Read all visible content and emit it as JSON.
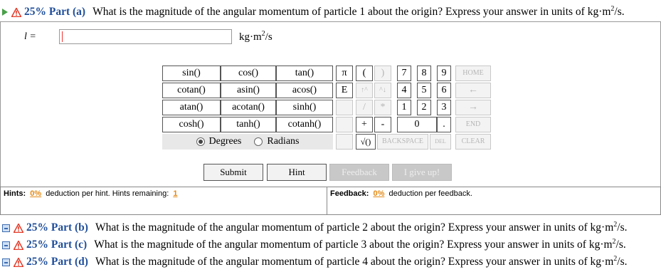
{
  "parts": {
    "a": {
      "percent": "25% Part (a)",
      "question": "What is the magnitude of the angular momentum of particle 1 about the origin? Express your answer in units of kg·m",
      "unit_sup": "2",
      "unit_end": "/s."
    },
    "b": {
      "percent": "25% Part (b)",
      "question": "What is the magnitude of the angular momentum of particle 2 about the origin? Express your answer in units of kg·m",
      "unit_sup": "2",
      "unit_end": "/s."
    },
    "c": {
      "percent": "25% Part (c)",
      "question": "What is the magnitude of the angular momentum of particle 3 about the origin? Express your answer in units of kg·m",
      "unit_sup": "2",
      "unit_end": "/s."
    },
    "d": {
      "percent": "25% Part (d)",
      "question": "What is the magnitude of the angular momentum of particle 4 about the origin? Express your answer in units of kg·m",
      "unit_sup": "2",
      "unit_end": "/s."
    }
  },
  "answer": {
    "label": "l =",
    "value": "",
    "unit": "kg·m",
    "unit_sup": "2",
    "unit_end": "/s"
  },
  "functions": {
    "sin": "sin()",
    "cos": "cos()",
    "tan": "tan()",
    "cotan": "cotan()",
    "asin": "asin()",
    "acos": "acos()",
    "atan": "atan()",
    "acotan": "acotan()",
    "sinh": "sinh()",
    "cosh": "cosh()",
    "tanh": "tanh()",
    "cotanh": "cotanh()"
  },
  "keypad": {
    "pi": "π",
    "lparen": "(",
    "rparen": ")",
    "k7": "7",
    "k8": "8",
    "k9": "9",
    "home": "HOME",
    "E": "E",
    "up": "↑^",
    "up2": "^↓",
    "k4": "4",
    "k5": "5",
    "k6": "6",
    "left": "←",
    "slash": "/",
    "star": "*",
    "k1": "1",
    "k2": "2",
    "k3": "3",
    "right": "→",
    "plus": "+",
    "minus": "-",
    "k0": "0",
    "dot": ".",
    "end": "END",
    "sqrt": "√()",
    "backspace": "BACKSPACE",
    "del": "DEL",
    "clear": "CLEAR"
  },
  "angle": {
    "degrees": "Degrees",
    "radians": "Radians",
    "selected": "Degrees"
  },
  "actions": {
    "submit": "Submit",
    "hint": "Hint",
    "feedback": "Feedback",
    "give_up": "I give up!"
  },
  "hints": {
    "label": "Hints:",
    "pct": "0%",
    "text": "deduction per hint. Hints remaining:",
    "remaining": "1"
  },
  "feedback": {
    "label": "Feedback:",
    "pct": "0%",
    "text": "deduction per feedback."
  },
  "colors": {
    "accent": "#1f4e9a",
    "warning": "#e23b2a",
    "orange": "#e28a17",
    "play": "#4aa04a"
  }
}
